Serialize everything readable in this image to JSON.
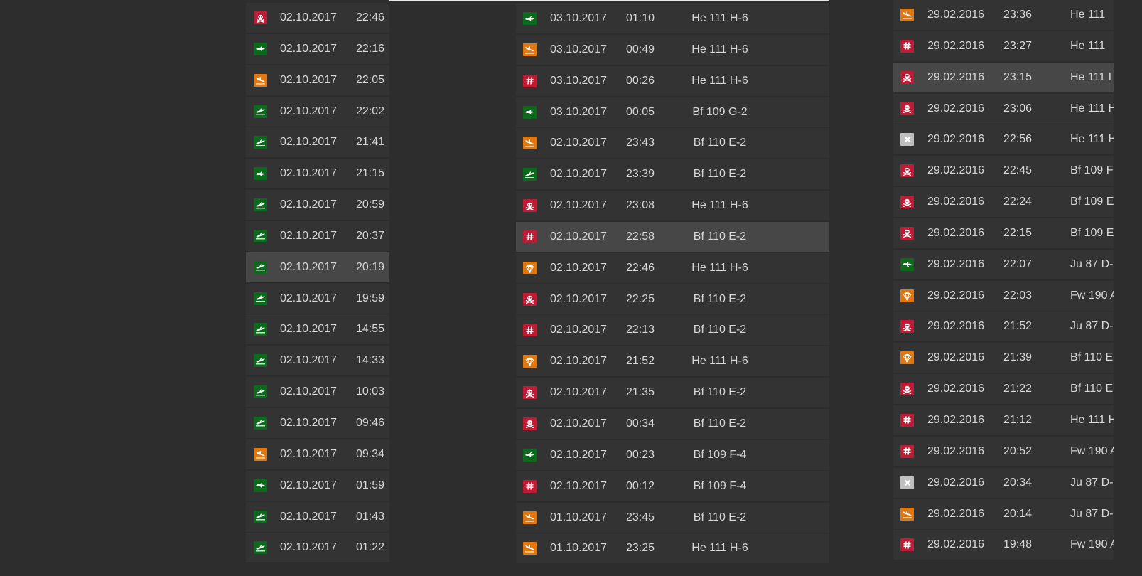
{
  "icon_legend": {
    "kill": {
      "icon": "skull-crossbones-icon",
      "color": "#c01a35"
    },
    "flight": {
      "icon": "plane-flying-icon",
      "color": "#0c6a1d"
    },
    "takeoff": {
      "icon": "plane-takeoff-icon",
      "color": "#0c6a1d"
    },
    "landing": {
      "icon": "plane-landing-icon",
      "color": "#e0780f"
    },
    "hit": {
      "icon": "hash-icon",
      "color": "#c01a35"
    },
    "parachute": {
      "icon": "parachute-icon",
      "color": "#e0780f"
    },
    "crash": {
      "icon": "cross-icon",
      "color": "#bfbfbf"
    }
  },
  "left_list": [
    {
      "icon": "kill",
      "date": "02.10.2017",
      "time": "22:46"
    },
    {
      "icon": "flight",
      "date": "02.10.2017",
      "time": "22:16"
    },
    {
      "icon": "landing",
      "date": "02.10.2017",
      "time": "22:05"
    },
    {
      "icon": "takeoff",
      "date": "02.10.2017",
      "time": "22:02"
    },
    {
      "icon": "takeoff",
      "date": "02.10.2017",
      "time": "21:41"
    },
    {
      "icon": "flight",
      "date": "02.10.2017",
      "time": "21:15"
    },
    {
      "icon": "takeoff",
      "date": "02.10.2017",
      "time": "20:59"
    },
    {
      "icon": "takeoff",
      "date": "02.10.2017",
      "time": "20:37"
    },
    {
      "icon": "takeoff",
      "date": "02.10.2017",
      "time": "20:19",
      "highlighted": true
    },
    {
      "icon": "takeoff",
      "date": "02.10.2017",
      "time": "19:59"
    },
    {
      "icon": "takeoff",
      "date": "02.10.2017",
      "time": "14:55"
    },
    {
      "icon": "takeoff",
      "date": "02.10.2017",
      "time": "14:33"
    },
    {
      "icon": "takeoff",
      "date": "02.10.2017",
      "time": "10:03"
    },
    {
      "icon": "takeoff",
      "date": "02.10.2017",
      "time": "09:46"
    },
    {
      "icon": "landing",
      "date": "02.10.2017",
      "time": "09:34"
    },
    {
      "icon": "flight",
      "date": "02.10.2017",
      "time": "01:59"
    },
    {
      "icon": "takeoff",
      "date": "02.10.2017",
      "time": "01:43"
    },
    {
      "icon": "takeoff",
      "date": "02.10.2017",
      "time": "01:22"
    }
  ],
  "middle_list": [
    {
      "icon": "flight",
      "date": "03.10.2017",
      "time": "01:10",
      "plane": "He 111 H-6"
    },
    {
      "icon": "landing",
      "date": "03.10.2017",
      "time": "00:49",
      "plane": "He 111 H-6"
    },
    {
      "icon": "hit",
      "date": "03.10.2017",
      "time": "00:26",
      "plane": "He 111 H-6"
    },
    {
      "icon": "flight",
      "date": "03.10.2017",
      "time": "00:05",
      "plane": "Bf 109 G-2"
    },
    {
      "icon": "landing",
      "date": "02.10.2017",
      "time": "23:43",
      "plane": "Bf 110 E-2"
    },
    {
      "icon": "takeoff",
      "date": "02.10.2017",
      "time": "23:39",
      "plane": "Bf 110 E-2"
    },
    {
      "icon": "kill",
      "date": "02.10.2017",
      "time": "23:08",
      "plane": "He 111 H-6"
    },
    {
      "icon": "hit",
      "date": "02.10.2017",
      "time": "22:58",
      "plane": "Bf 110 E-2",
      "highlighted": true
    },
    {
      "icon": "parachute",
      "date": "02.10.2017",
      "time": "22:46",
      "plane": "He 111 H-6"
    },
    {
      "icon": "kill",
      "date": "02.10.2017",
      "time": "22:25",
      "plane": "Bf 110 E-2"
    },
    {
      "icon": "hit",
      "date": "02.10.2017",
      "time": "22:13",
      "plane": "Bf 110 E-2"
    },
    {
      "icon": "parachute",
      "date": "02.10.2017",
      "time": "21:52",
      "plane": "He 111 H-6"
    },
    {
      "icon": "kill",
      "date": "02.10.2017",
      "time": "21:35",
      "plane": "Bf 110 E-2"
    },
    {
      "icon": "kill",
      "date": "02.10.2017",
      "time": "00:34",
      "plane": "Bf 110 E-2"
    },
    {
      "icon": "flight",
      "date": "02.10.2017",
      "time": "00:23",
      "plane": "Bf 109 F-4"
    },
    {
      "icon": "hit",
      "date": "02.10.2017",
      "time": "00:12",
      "plane": "Bf 109 F-4"
    },
    {
      "icon": "landing",
      "date": "01.10.2017",
      "time": "23:45",
      "plane": "Bf 110 E-2"
    },
    {
      "icon": "landing",
      "date": "01.10.2017",
      "time": "23:25",
      "plane": "He 111 H-6"
    }
  ],
  "right_list": [
    {
      "icon": "landing",
      "date": "29.02.2016",
      "time": "23:36",
      "plane": "He 111"
    },
    {
      "icon": "hit",
      "date": "29.02.2016",
      "time": "23:27",
      "plane": "He 111"
    },
    {
      "icon": "kill",
      "date": "29.02.2016",
      "time": "23:15",
      "plane": "He 111 I",
      "highlighted": true
    },
    {
      "icon": "kill",
      "date": "29.02.2016",
      "time": "23:06",
      "plane": "He 111 H"
    },
    {
      "icon": "crash",
      "date": "29.02.2016",
      "time": "22:56",
      "plane": "He 111 H"
    },
    {
      "icon": "kill",
      "date": "29.02.2016",
      "time": "22:45",
      "plane": "Bf 109 F"
    },
    {
      "icon": "kill",
      "date": "29.02.2016",
      "time": "22:24",
      "plane": "Bf 109 E"
    },
    {
      "icon": "kill",
      "date": "29.02.2016",
      "time": "22:15",
      "plane": "Bf 109 E"
    },
    {
      "icon": "flight",
      "date": "29.02.2016",
      "time": "22:07",
      "plane": "Ju 87 D-"
    },
    {
      "icon": "parachute",
      "date": "29.02.2016",
      "time": "22:03",
      "plane": "Fw 190 A"
    },
    {
      "icon": "kill",
      "date": "29.02.2016",
      "time": "21:52",
      "plane": "Ju 87 D-"
    },
    {
      "icon": "parachute",
      "date": "29.02.2016",
      "time": "21:39",
      "plane": "Bf 110 E"
    },
    {
      "icon": "kill",
      "date": "29.02.2016",
      "time": "21:22",
      "plane": "Bf 110 E"
    },
    {
      "icon": "hit",
      "date": "29.02.2016",
      "time": "21:12",
      "plane": "He 111 H"
    },
    {
      "icon": "hit",
      "date": "29.02.2016",
      "time": "20:52",
      "plane": "Fw 190 A"
    },
    {
      "icon": "crash",
      "date": "29.02.2016",
      "time": "20:34",
      "plane": "Ju 87 D-"
    },
    {
      "icon": "landing",
      "date": "29.02.2016",
      "time": "20:14",
      "plane": "Ju 87 D-"
    },
    {
      "icon": "hit",
      "date": "29.02.2016",
      "time": "19:48",
      "plane": "Fw 190 A"
    }
  ]
}
